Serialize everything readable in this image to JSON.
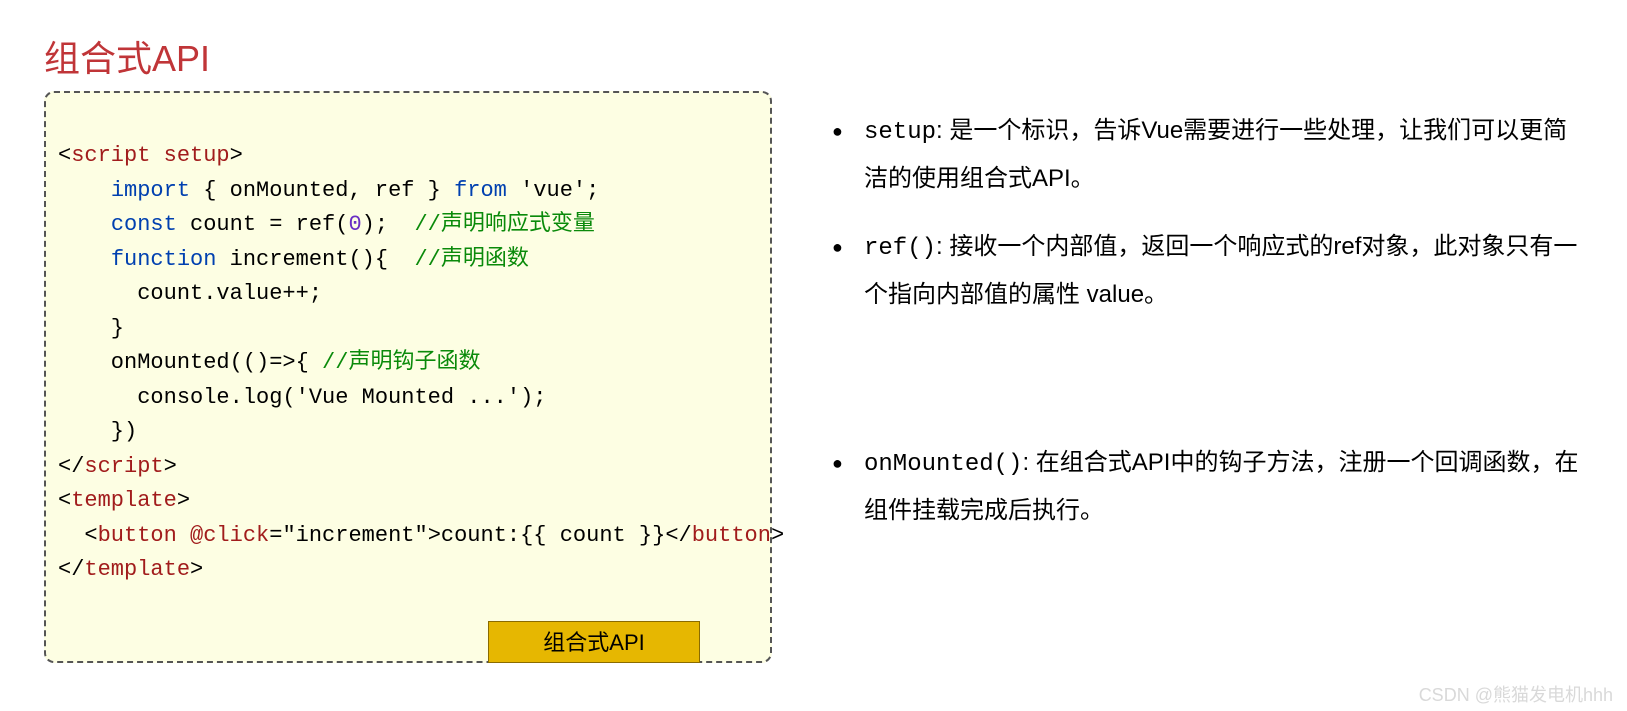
{
  "title": "组合式API",
  "code": {
    "l1_open": "<",
    "l1_tag": "script",
    "l1_attr": " setup",
    "l1_close": ">",
    "l2_pre": "    ",
    "l2_import": "import",
    "l2_mid": " { onMounted, ref } ",
    "l2_from": "from",
    "l2_end": " 'vue';",
    "l3_pre": "    ",
    "l3_const": "const",
    "l3_mid": " count = ref(",
    "l3_zero": "0",
    "l3_end": ");  ",
    "l3_comment": "//声明响应式变量",
    "l4_pre": "    ",
    "l4_function": "function",
    "l4_mid": " increment(){  ",
    "l4_comment": "//声明函数",
    "l5": "      count.value++;",
    "l6": "    }",
    "l7_pre": "    onMounted(()=>{ ",
    "l7_comment": "//声明钩子函数",
    "l8": "      console.log('Vue Mounted ...');",
    "l9": "    })",
    "l10_open": "</",
    "l10_tag": "script",
    "l10_close": ">",
    "l11_open": "<",
    "l11_tag": "template",
    "l11_close": ">",
    "l12_pre": "  ",
    "l12_open": "<",
    "l12_tag": "button",
    "l12_attr": " @click",
    "l12_eq": "=",
    "l12_val": "\"increment\"",
    "l12_mid": ">count:{{ count }}</",
    "l12_tag2": "button",
    "l12_end": ">",
    "l13_open": "</",
    "l13_tag": "template",
    "l13_close": ">"
  },
  "badge": "组合式API",
  "notes": {
    "item1_kw": "setup",
    "item1_text": ": 是一个标识，告诉Vue需要进行一些处理，让我们可以更简洁的使用组合式API。",
    "item2_kw": "ref()",
    "item2_text": ": 接收一个内部值，返回一个响应式的ref对象，此对象只有一个指向内部值的属性 value。",
    "item3_kw": "onMounted()",
    "item3_text": ": 在组合式API中的钩子方法，注册一个回调函数，在组件挂载完成后执行。"
  },
  "watermark": "CSDN @熊猫发电机hhh"
}
